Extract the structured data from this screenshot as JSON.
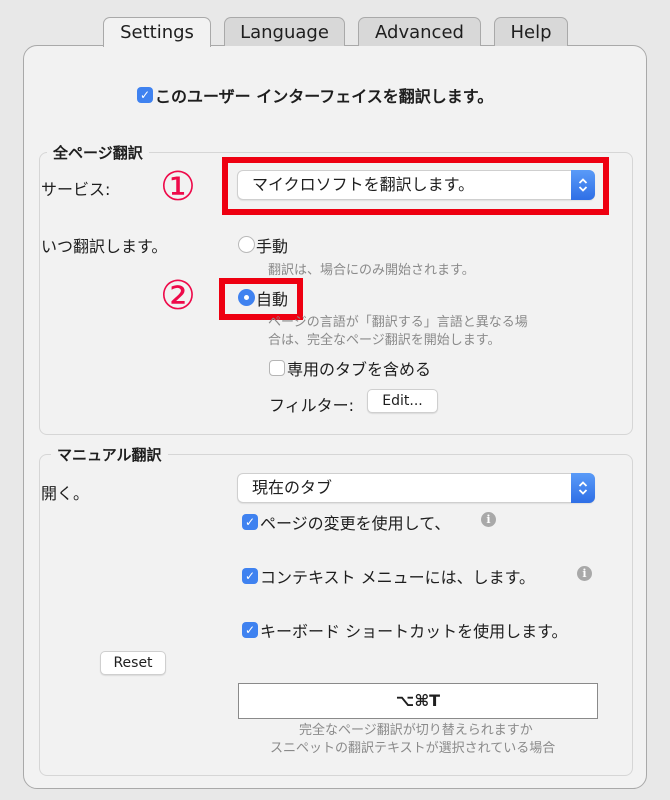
{
  "tabs": [
    {
      "label": "Settings",
      "active": true
    },
    {
      "label": "Language",
      "active": false
    },
    {
      "label": "Advanced",
      "active": false
    },
    {
      "label": "Help",
      "active": false
    }
  ],
  "translate_ui": {
    "label": "このユーザー インターフェイスを翻訳します。",
    "checked": true
  },
  "full_page": {
    "title": "全ページ翻訳",
    "service_label": "サービス:",
    "service_value": "マイクロソフトを翻訳します。",
    "when_label": "いつ翻訳します。",
    "manual_option": {
      "label": "手動",
      "selected": false,
      "hint": "翻訳は、場合にのみ開始されます。"
    },
    "auto_option": {
      "label": "自動",
      "selected": true,
      "hint_line1": "ページの言語が「翻訳する」言語と異なる場",
      "hint_line2": "合は、完全なページ翻訳を開始します。"
    },
    "include_private": {
      "label": "専用のタブを含める",
      "checked": false
    },
    "filter_label": "フィルター:",
    "edit_button": "Edit..."
  },
  "manual": {
    "title": "マニュアル翻訳",
    "open_label": "開く。",
    "open_value": "現在のタブ",
    "use_page_change": {
      "label": "ページの変更を使用して、",
      "checked": true
    },
    "context_menu": {
      "label": "コンテキスト メニューには、します。",
      "checked": true
    },
    "keyboard_shortcut": {
      "label": "キーボード ショートカットを使用します。",
      "checked": true
    },
    "reset_button": "Reset",
    "shortcut_value": "⌥⌘T",
    "shortcut_hint_line1": "完全なページ翻訳が切り替えられますか",
    "shortcut_hint_line2": "スニペットの翻訳テキストが選択されている場合"
  },
  "annotations": {
    "marker1": "①",
    "marker2": "②",
    "highlight_color": "#ee0011"
  },
  "colors": {
    "accent": "#3f82f0",
    "background": "#f2f2f2"
  }
}
